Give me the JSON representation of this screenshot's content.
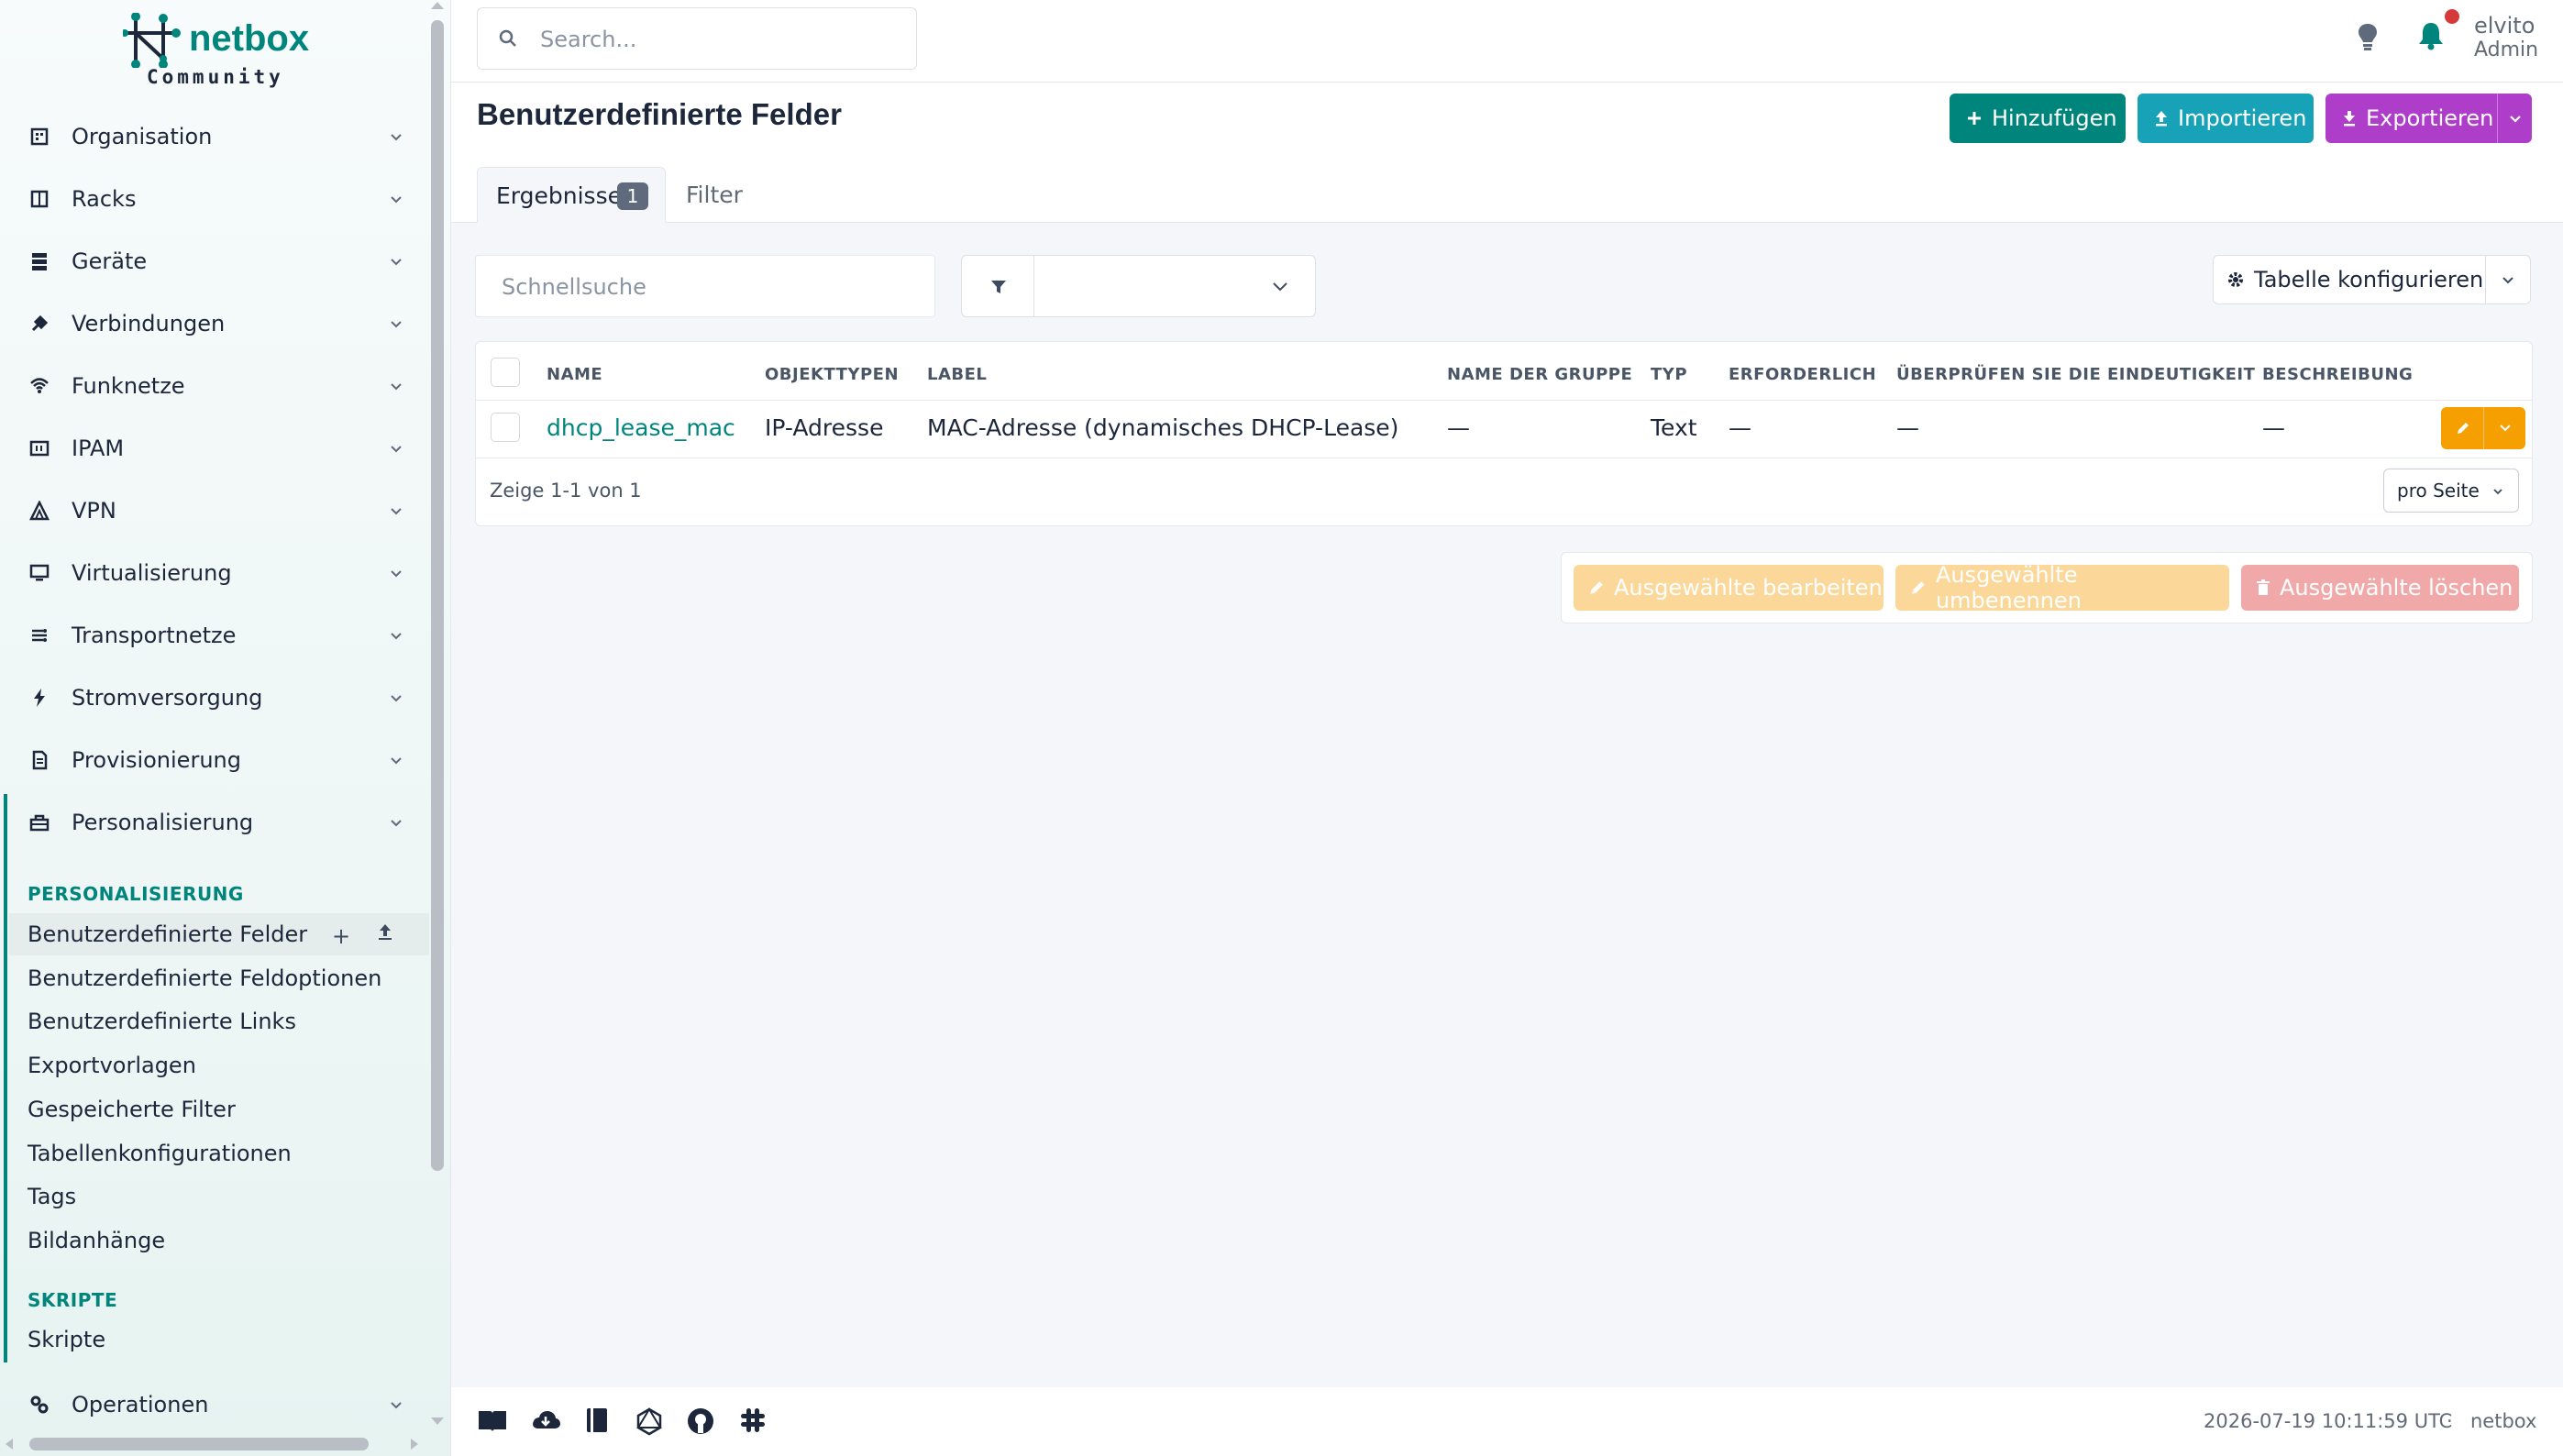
{
  "brand": {
    "name": "netbox",
    "edition": "Community"
  },
  "search": {
    "placeholder": "Search..."
  },
  "user": {
    "name": "elvito",
    "role": "Admin"
  },
  "nav": {
    "items": [
      {
        "label": "Organisation",
        "icon": "building-icon"
      },
      {
        "label": "Racks",
        "icon": "rack-icon"
      },
      {
        "label": "Geräte",
        "icon": "server-icon"
      },
      {
        "label": "Verbindungen",
        "icon": "plug-icon"
      },
      {
        "label": "Funknetze",
        "icon": "wifi-icon"
      },
      {
        "label": "IPAM",
        "icon": "counter-icon"
      },
      {
        "label": "VPN",
        "icon": "tunnel-icon"
      },
      {
        "label": "Virtualisierung",
        "icon": "monitor-icon"
      },
      {
        "label": "Transportnetze",
        "icon": "transit-icon"
      },
      {
        "label": "Stromversorgung",
        "icon": "flash-icon"
      },
      {
        "label": "Provisionierung",
        "icon": "file-document-icon"
      },
      {
        "label": "Personalisierung",
        "icon": "toolbox-icon"
      }
    ],
    "section_personalisierung": "PERSONALISIERUNG",
    "personalisierung_items": [
      "Benutzerdefinierte Felder",
      "Benutzerdefinierte Feldoptionen",
      "Benutzerdefinierte Links",
      "Exportvorlagen",
      "Gespeicherte Filter",
      "Tabellenkonfigurationen",
      "Tags",
      "Bildanhänge"
    ],
    "section_skripte": "SKRIPTE",
    "skripte_items": [
      "Skripte"
    ],
    "operationen": {
      "label": "Operationen",
      "icon": "cogs-icon"
    }
  },
  "page": {
    "title": "Benutzerdefinierte Felder",
    "add_label": "Hinzufügen",
    "import_label": "Importieren",
    "export_label": "Exportieren"
  },
  "tabs": {
    "results_label": "Ergebnisse",
    "results_count": "1",
    "filter_label": "Filter"
  },
  "toolbar": {
    "quicksearch_placeholder": "Schnellsuche",
    "filter_select_value": "",
    "configure_label": "Tabelle konfigurieren"
  },
  "table": {
    "columns": [
      "NAME",
      "OBJEKTTYPEN",
      "LABEL",
      "NAME DER GRUPPE",
      "TYP",
      "ERFORDERLICH",
      "ÜBERPRÜFEN SIE DIE EINDEUTIGKEIT",
      "BESCHREIBUNG"
    ],
    "rows": [
      [
        "dhcp_lease_mac",
        "IP-Adresse",
        "MAC-Adresse (dynamisches DHCP-Lease)",
        "—",
        "Text",
        "—",
        "—",
        "—"
      ]
    ],
    "showing": "Zeige 1-1 von 1",
    "per_page_label": "pro Seite"
  },
  "bulk": {
    "edit_label": "Ausgewählte bearbeiten",
    "rename_label": "Ausgewählte umbenennen",
    "delete_label": "Ausgewählte löschen"
  },
  "footer": {
    "timestamp": "2026-07-19 10:11:59 UTC",
    "separator": "·",
    "app": "netbox"
  },
  "colors": {
    "brand": "#00857d",
    "info": "#17a2b8",
    "purple": "#ae3ec9",
    "warning": "#f59f00",
    "danger_disabled": "#f0a8a8"
  }
}
